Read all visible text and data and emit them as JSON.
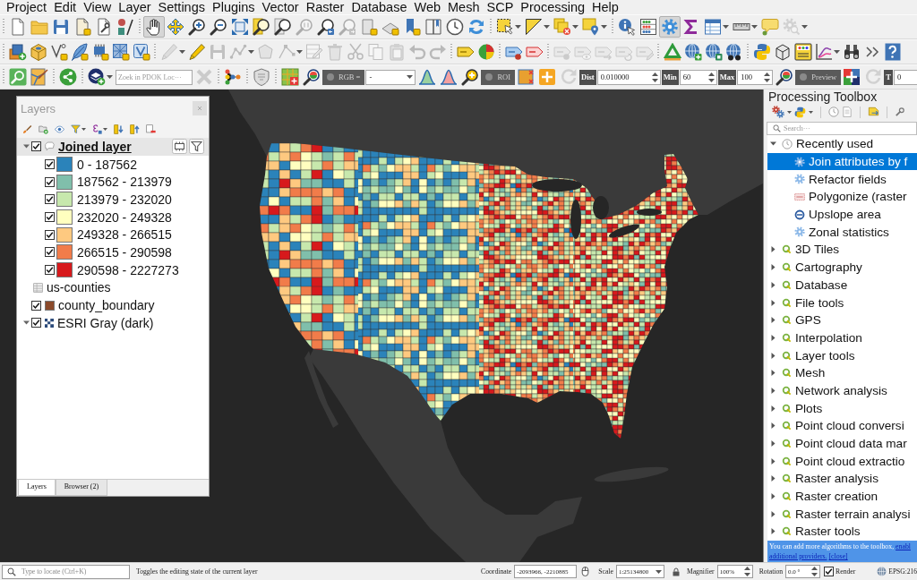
{
  "menu_bar": [
    "Project",
    "Edit",
    "View",
    "Layer",
    "Settings",
    "Plugins",
    "Vector",
    "Raster",
    "Database",
    "Web",
    "Mesh",
    "SCP",
    "Processing",
    "Help"
  ],
  "toolbars": [
    [
      {
        "kind": "button",
        "disabled": false,
        "on": false,
        "menu": false
      },
      {
        "kind": "button",
        "disabled": false,
        "on": false,
        "menu": false
      },
      {
        "kind": "button",
        "disabled": false,
        "on": false,
        "menu": false
      },
      {
        "kind": "button",
        "disabled": false,
        "on": false,
        "menu": false
      },
      {
        "kind": "button",
        "disabled": false,
        "on": false,
        "menu": false
      },
      {
        "kind": "button",
        "disabled": false,
        "on": false,
        "menu": false
      },
      {
        "kind": "separator"
      },
      {
        "kind": "button",
        "disabled": false,
        "on": true,
        "menu": false
      },
      {
        "kind": "button",
        "disabled": false,
        "on": false,
        "menu": false
      },
      {
        "kind": "button",
        "disabled": false,
        "on": false,
        "menu": false
      },
      {
        "kind": "button",
        "disabled": false,
        "on": false,
        "menu": false
      },
      {
        "kind": "button",
        "disabled": false,
        "on": false,
        "menu": false
      },
      {
        "kind": "button",
        "disabled": false,
        "on": false,
        "menu": false
      },
      {
        "kind": "button",
        "disabled": false,
        "on": false,
        "menu": false
      },
      {
        "kind": "button",
        "disabled": true,
        "on": false,
        "menu": false
      },
      {
        "kind": "button",
        "disabled": false,
        "on": false,
        "menu": false
      },
      {
        "kind": "button",
        "disabled": true,
        "on": false,
        "menu": false
      },
      {
        "kind": "button",
        "disabled": false,
        "on": false,
        "menu": false
      },
      {
        "kind": "button",
        "disabled": false,
        "on": false,
        "menu": false
      },
      {
        "kind": "button",
        "disabled": false,
        "on": false,
        "menu": false
      },
      {
        "kind": "button",
        "disabled": false,
        "on": false,
        "menu": false
      },
      {
        "kind": "button",
        "disabled": false,
        "on": false,
        "menu": false
      },
      {
        "kind": "button",
        "disabled": false,
        "on": false,
        "menu": false
      },
      {
        "kind": "separator"
      },
      {
        "kind": "button",
        "disabled": false,
        "on": false,
        "menu": true
      },
      {
        "kind": "button",
        "disabled": false,
        "on": false,
        "menu": true
      },
      {
        "kind": "button",
        "disabled": false,
        "on": false,
        "menu": true
      },
      {
        "kind": "button",
        "disabled": false,
        "on": false,
        "menu": true
      },
      {
        "kind": "separator"
      },
      {
        "kind": "button",
        "disabled": false,
        "on": false,
        "menu": false
      },
      {
        "kind": "button",
        "disabled": false,
        "on": false,
        "menu": false
      },
      {
        "kind": "button",
        "disabled": false,
        "on": true,
        "menu": false
      },
      {
        "kind": "button",
        "disabled": false,
        "on": false,
        "menu": false
      },
      {
        "kind": "button",
        "disabled": false,
        "on": false,
        "menu": true
      },
      {
        "kind": "button",
        "disabled": false,
        "on": false,
        "menu": true
      },
      {
        "kind": "button",
        "disabled": false,
        "on": false,
        "menu": false
      },
      {
        "kind": "button",
        "disabled": true,
        "on": false,
        "menu": true
      }
    ],
    [
      {
        "kind": "button",
        "disabled": false,
        "on": false,
        "menu": false
      },
      {
        "kind": "button",
        "disabled": false,
        "on": false,
        "menu": false
      },
      {
        "kind": "button",
        "disabled": false,
        "on": false,
        "menu": false
      },
      {
        "kind": "button",
        "disabled": false,
        "on": false,
        "menu": false
      },
      {
        "kind": "button",
        "disabled": false,
        "on": false,
        "menu": false
      },
      {
        "kind": "button",
        "disabled": false,
        "on": false,
        "menu": false
      },
      {
        "kind": "button",
        "disabled": false,
        "on": false,
        "menu": false
      },
      {
        "kind": "separator"
      },
      {
        "kind": "button",
        "disabled": true,
        "on": false,
        "menu": true
      },
      {
        "kind": "button",
        "disabled": false,
        "on": false,
        "menu": false
      },
      {
        "kind": "button",
        "disabled": true,
        "on": false,
        "menu": false
      },
      {
        "kind": "button",
        "disabled": true,
        "on": false,
        "menu": true
      },
      {
        "kind": "button",
        "disabled": true,
        "on": false,
        "menu": false
      },
      {
        "kind": "button",
        "disabled": true,
        "on": false,
        "menu": true
      },
      {
        "kind": "button",
        "disabled": true,
        "on": false,
        "menu": false
      },
      {
        "kind": "button",
        "disabled": true,
        "on": false,
        "menu": false
      },
      {
        "kind": "button",
        "disabled": true,
        "on": false,
        "menu": false
      },
      {
        "kind": "button",
        "disabled": true,
        "on": false,
        "menu": false
      },
      {
        "kind": "button",
        "disabled": true,
        "on": false,
        "menu": false
      },
      {
        "kind": "button",
        "disabled": true,
        "on": false,
        "menu": false
      },
      {
        "kind": "button",
        "disabled": true,
        "on": false,
        "menu": false
      },
      {
        "kind": "separator"
      },
      {
        "kind": "button",
        "disabled": false,
        "on": false,
        "menu": false
      },
      {
        "kind": "button",
        "disabled": false,
        "on": false,
        "menu": false
      },
      {
        "kind": "separator"
      },
      {
        "kind": "button",
        "disabled": false,
        "on": false,
        "menu": false
      },
      {
        "kind": "button",
        "disabled": false,
        "on": false,
        "menu": false
      },
      {
        "kind": "separator"
      },
      {
        "kind": "button",
        "disabled": true,
        "on": false,
        "menu": false
      },
      {
        "kind": "button",
        "disabled": true,
        "on": false,
        "menu": false
      },
      {
        "kind": "button",
        "disabled": true,
        "on": false,
        "menu": false
      },
      {
        "kind": "button",
        "disabled": true,
        "on": false,
        "menu": false
      },
      {
        "kind": "button",
        "disabled": true,
        "on": false,
        "menu": false
      },
      {
        "kind": "separator"
      },
      {
        "kind": "button",
        "disabled": false,
        "on": false,
        "menu": false
      },
      {
        "kind": "button",
        "disabled": false,
        "on": false,
        "menu": false
      },
      {
        "kind": "button",
        "disabled": false,
        "on": false,
        "menu": false
      },
      {
        "kind": "button",
        "disabled": false,
        "on": false,
        "menu": false
      },
      {
        "kind": "separator"
      },
      {
        "kind": "button",
        "disabled": false,
        "on": false,
        "menu": false
      },
      {
        "kind": "button",
        "disabled": false,
        "on": false,
        "menu": false
      },
      {
        "kind": "button",
        "disabled": false,
        "on": false,
        "menu": false
      },
      {
        "kind": "button",
        "disabled": false,
        "on": false,
        "menu": true
      },
      {
        "kind": "button",
        "disabled": false,
        "on": false,
        "menu": false
      },
      {
        "kind": "button",
        "disabled": false,
        "on": false,
        "menu": false
      },
      {
        "kind": "button",
        "disabled": false,
        "on": false,
        "menu": false
      }
    ],
    [
      {
        "kind": "button",
        "disabled": false,
        "on": false,
        "menu": false
      },
      {
        "kind": "button",
        "disabled": false,
        "on": false,
        "menu": false
      },
      {
        "kind": "separator"
      },
      {
        "kind": "button",
        "disabled": false,
        "on": false,
        "menu": false
      },
      {
        "kind": "separator"
      },
      {
        "kind": "button",
        "disabled": false,
        "on": false,
        "menu": true
      },
      {
        "kind": "search",
        "placeholder": "Zoek in PDOK Loc···"
      },
      {
        "kind": "button",
        "disabled": true,
        "on": false,
        "menu": false
      },
      {
        "kind": "separator"
      },
      {
        "kind": "button",
        "disabled": false,
        "on": false,
        "menu": false
      },
      {
        "kind": "separator"
      },
      {
        "kind": "button",
        "disabled": false,
        "on": false,
        "menu": false
      },
      {
        "kind": "separator"
      },
      {
        "kind": "button",
        "disabled": false,
        "on": false,
        "menu": false
      },
      {
        "kind": "button",
        "disabled": false,
        "on": false,
        "menu": false
      },
      {
        "kind": "toggle",
        "label": "RGB =",
        "on": false
      },
      {
        "kind": "combo",
        "value": "-"
      },
      {
        "kind": "button",
        "disabled": false,
        "on": false,
        "menu": false
      },
      {
        "kind": "button",
        "disabled": false,
        "on": false,
        "menu": false
      },
      {
        "kind": "button",
        "disabled": false,
        "on": false,
        "menu": false
      },
      {
        "kind": "toggle",
        "label": "ROI",
        "on": false
      },
      {
        "kind": "button",
        "disabled": false,
        "on": false,
        "menu": false
      },
      {
        "kind": "button",
        "disabled": false,
        "on": false,
        "menu": false
      },
      {
        "kind": "button",
        "disabled": true,
        "on": false,
        "menu": false
      },
      {
        "kind": "label",
        "text": "Dist"
      },
      {
        "kind": "spin",
        "value": "0.010000"
      },
      {
        "kind": "label",
        "text": "Min"
      },
      {
        "kind": "spin",
        "value": "60"
      },
      {
        "kind": "label",
        "text": "Max"
      },
      {
        "kind": "spin",
        "value": "100"
      },
      {
        "kind": "button",
        "disabled": false,
        "on": false,
        "menu": false
      },
      {
        "kind": "toggle",
        "label": "Preview",
        "on": false
      },
      {
        "kind": "button",
        "disabled": false,
        "on": false,
        "menu": false
      },
      {
        "kind": "button",
        "disabled": true,
        "on": false,
        "menu": false
      },
      {
        "kind": "label",
        "text": "T"
      },
      {
        "kind": "spin",
        "value": "0"
      }
    ]
  ],
  "layers_panel": {
    "title": "Layers",
    "layers": [
      {
        "name": "Joined layer",
        "kind": "graduated",
        "checked": true,
        "expanded": true,
        "selected": true,
        "temporary": true,
        "filtered": true,
        "legend": [
          {
            "label": "0 - 187562",
            "checked": true,
            "color": "#2b83ba"
          },
          {
            "label": "187562 - 213979",
            "checked": true,
            "color": "#80bfab"
          },
          {
            "label": "213979 - 232020",
            "checked": true,
            "color": "#c7e8ad"
          },
          {
            "label": "232020 - 249328",
            "checked": true,
            "color": "#ffffbf"
          },
          {
            "label": "249328 - 266515",
            "checked": true,
            "color": "#fec980"
          },
          {
            "label": "266515 - 290598",
            "checked": true,
            "color": "#f17c4a"
          },
          {
            "label": "290598 - 2227273",
            "checked": true,
            "color": "#d7191c"
          }
        ]
      },
      {
        "name": "us-counties",
        "kind": "table",
        "selected": false,
        "temporary": false,
        "filtered": false
      },
      {
        "name": "county_boundary",
        "kind": "single",
        "checked": true,
        "selected": false,
        "temporary": false,
        "filtered": false,
        "color": "#8b4a2b"
      },
      {
        "name": "ESRI Gray (dark)",
        "kind": "raster",
        "checked": true,
        "expanded": true,
        "selected": false,
        "temporary": false,
        "filtered": false
      }
    ],
    "tabs": [
      {
        "label": "Layers",
        "selected": true
      },
      {
        "label": "Browser (2)",
        "selected": false
      }
    ]
  },
  "processing_toolbox": {
    "title": "Processing Toolbox",
    "search": {
      "placeholder": "Search···"
    },
    "tree": [
      {
        "label": "Recently used",
        "kind": "recent",
        "expanded": true,
        "selected": false,
        "children": [
          {
            "label": "Join attributes by f",
            "kind": "native",
            "selected": true
          },
          {
            "label": "Refactor fields",
            "kind": "native",
            "selected": false
          },
          {
            "label": "Polygonize (raster",
            "kind": "gdal",
            "selected": false
          },
          {
            "label": "Upslope area",
            "kind": "saga",
            "selected": false
          },
          {
            "label": "Zonal statistics",
            "kind": "native",
            "selected": false
          }
        ]
      },
      {
        "label": "3D Tiles",
        "kind": "provider",
        "expanded": false,
        "selected": false
      },
      {
        "label": "Cartography",
        "kind": "provider",
        "expanded": false,
        "selected": false
      },
      {
        "label": "Database",
        "kind": "provider",
        "expanded": false,
        "selected": false
      },
      {
        "label": "File tools",
        "kind": "provider",
        "expanded": false,
        "selected": false
      },
      {
        "label": "GPS",
        "kind": "provider",
        "expanded": false,
        "selected": false
      },
      {
        "label": "Interpolation",
        "kind": "provider",
        "expanded": false,
        "selected": false
      },
      {
        "label": "Layer tools",
        "kind": "provider",
        "expanded": false,
        "selected": false
      },
      {
        "label": "Mesh",
        "kind": "provider",
        "expanded": false,
        "selected": false
      },
      {
        "label": "Network analysis",
        "kind": "provider",
        "expanded": false,
        "selected": false
      },
      {
        "label": "Plots",
        "kind": "provider",
        "expanded": false,
        "selected": false
      },
      {
        "label": "Point cloud conversi",
        "kind": "provider",
        "expanded": false,
        "selected": false
      },
      {
        "label": "Point cloud data mar",
        "kind": "provider",
        "expanded": false,
        "selected": false
      },
      {
        "label": "Point cloud extractio",
        "kind": "provider",
        "expanded": false,
        "selected": false
      },
      {
        "label": "Raster analysis",
        "kind": "provider",
        "expanded": false,
        "selected": false
      },
      {
        "label": "Raster creation",
        "kind": "provider",
        "expanded": false,
        "selected": false
      },
      {
        "label": "Raster terrain analysi",
        "kind": "provider",
        "expanded": false,
        "selected": false
      },
      {
        "label": "Raster tools",
        "kind": "provider",
        "expanded": false,
        "selected": false
      }
    ],
    "banner": {
      "text": "You can add more algorithms to the toolbox,",
      "links": [
        "enabl",
        "additional providers.",
        "[close]"
      ]
    }
  },
  "status_bar": {
    "locator": {
      "placeholder": "Type to locate (Ctrl+K)"
    },
    "message": "Toggles the editing state of the current layer",
    "coordinate": {
      "label": "Coordinate",
      "value": "-2093966, -2210885"
    },
    "scale": {
      "label": "Scale",
      "value": "1:25134800"
    },
    "magnifier": {
      "label": "Magnifier",
      "value": "100%"
    },
    "rotation": {
      "label": "Rotation",
      "value": "0.0 °"
    },
    "render": {
      "label": "Render",
      "checked": true
    },
    "crs": "EPSG:216"
  }
}
